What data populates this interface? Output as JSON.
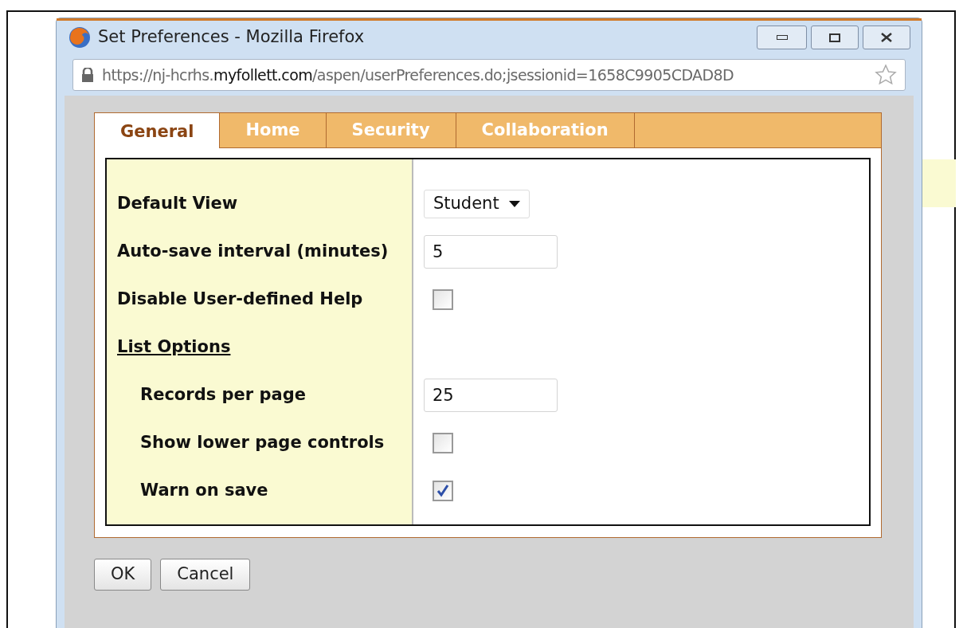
{
  "window": {
    "title": "Set Preferences - Mozilla Firefox"
  },
  "address_bar": {
    "prefix": "https://nj-hcrhs.",
    "domain": "myfollett.com",
    "path": "/aspen/userPreferences.do;jsessionid=1658C9905CDAD8D"
  },
  "tabs": [
    {
      "label": "General",
      "selected": true
    },
    {
      "label": "Home",
      "selected": false
    },
    {
      "label": "Security",
      "selected": false
    },
    {
      "label": "Collaboration",
      "selected": false
    }
  ],
  "rows": [
    {
      "kind": "select",
      "label": "Default View",
      "value": "Student"
    },
    {
      "kind": "text",
      "label": "Auto-save interval (minutes)",
      "value": "5"
    },
    {
      "kind": "checkbox",
      "label": "Disable User-defined Help",
      "checked": false
    },
    {
      "kind": "section",
      "label": "List Options",
      "children": [
        {
          "kind": "text",
          "label": "Records per page",
          "value": "25"
        },
        {
          "kind": "checkbox",
          "label": "Show lower page controls",
          "checked": false
        },
        {
          "kind": "checkbox",
          "label": "Warn on save",
          "checked": true
        }
      ]
    }
  ],
  "buttons": [
    "OK",
    "Cancel"
  ]
}
